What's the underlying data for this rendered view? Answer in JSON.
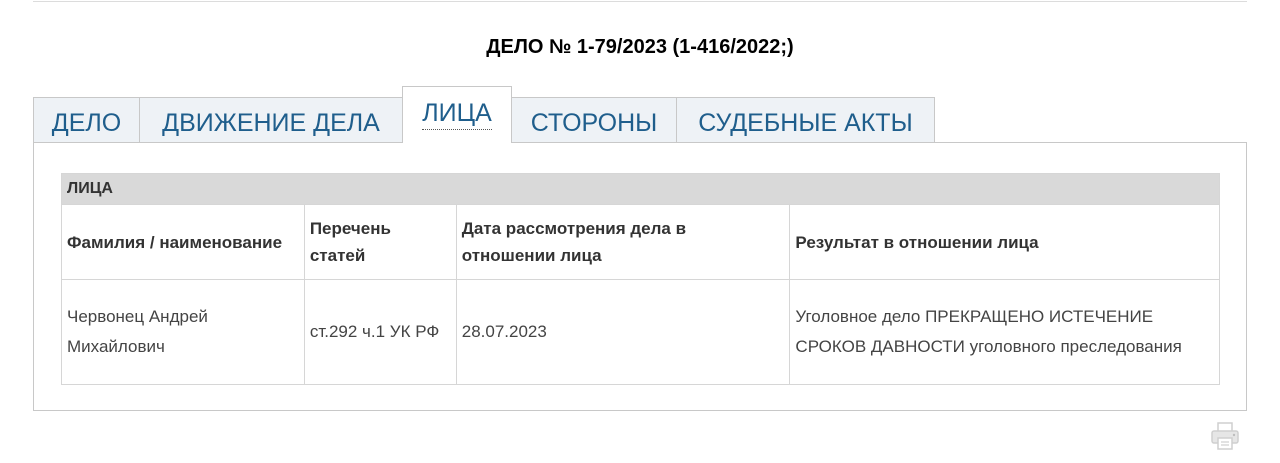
{
  "case": {
    "title": "ДЕЛО № 1-79/2023 (1-416/2022;)"
  },
  "tabs": [
    {
      "label": "ДЕЛО",
      "active": false
    },
    {
      "label": "ДВИЖЕНИЕ ДЕЛА",
      "active": false
    },
    {
      "label": "ЛИЦА",
      "active": true
    },
    {
      "label": "СТОРОНЫ",
      "active": false
    },
    {
      "label": "СУДЕБНЫЕ АКТЫ",
      "active": false
    }
  ],
  "persons_table": {
    "section_title": "ЛИЦА",
    "columns": [
      "Фамилия / наименование",
      "Перечень статей",
      "Дата рассмотрения дела в отношении лица",
      "Результат в отношении лица"
    ],
    "rows": [
      {
        "name": "Червонец Андрей Михайлович",
        "articles": "ст.292 ч.1 УК РФ",
        "date": "28.07.2023",
        "result": "Уголовное дело ПРЕКРАЩЕНО ИСТЕЧЕНИЕ СРОКОВ ДАВНОСТИ уголовного преследования"
      }
    ]
  },
  "icons": {
    "print": "printer-icon"
  },
  "colors": {
    "tab_text": "#1f5e8c",
    "tab_inactive_bg": "#eef2f6",
    "section_header_bg": "#d9d9d9",
    "border": "#c8c8c8"
  }
}
